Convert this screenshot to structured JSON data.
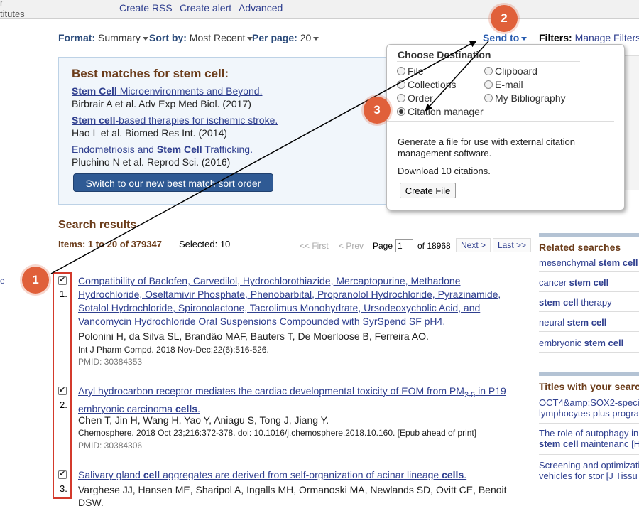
{
  "topbar": {
    "left_fragment_top": "r",
    "left_fragment": "titutes",
    "links": [
      "Create RSS",
      "Create alert",
      "Advanced"
    ]
  },
  "toolbar": {
    "format_label": "Format:",
    "format_value": "Summary",
    "sort_label": "Sort by:",
    "sort_value": "Most Recent",
    "perpage_label": "Per page:",
    "perpage_value": "20",
    "send_to": "Send to",
    "filters_label": "Filters:",
    "filters_link": "Manage Filters"
  },
  "best_matches": {
    "title": "Best matches for stem cell:",
    "items": [
      {
        "bold": "Stem Cell",
        "rest": " Microenvironments and Beyond.",
        "source": "Birbrair A et al. Adv Exp Med Biol. (2017)"
      },
      {
        "bold": "Stem cell",
        "rest": "-based therapies for ischemic stroke.",
        "source": "Hao L et al. Biomed Res Int. (2014)"
      },
      {
        "pre": "Endometriosis and ",
        "bold": "Stem Cell",
        "rest": " Trafficking.",
        "source": "Pluchino N et al. Reprod Sci. (2016)"
      }
    ],
    "switch_button": "Switch to our new best match sort order"
  },
  "destination": {
    "heading": "Choose Destination",
    "options": [
      "File",
      "Clipboard",
      "Collections",
      "E-mail",
      "Order",
      "My Bibliography",
      "Citation manager"
    ],
    "selected": "Citation manager",
    "description": "Generate a file for use with external citation management software.",
    "count": "Download 10 citations.",
    "button": "Create File"
  },
  "results": {
    "title": "Search results",
    "items_label": "Items: 1 to 20 of 379347",
    "selected_label": "Selected: 10",
    "pager": {
      "first": "<< First",
      "prev": "< Prev",
      "page_label": "Page",
      "page_value": "1",
      "of": "of 18968",
      "next": "Next >",
      "last": "Last >>"
    },
    "list": [
      {
        "num": "1.",
        "title": "Compatibility of Baclofen, Carvedilol, Hydrochlorothiazide, Mercaptopurine, Methadone Hydrochloride, Oseltamivir Phosphate, Phenobarbital, Propranolol Hydrochloride, Pyrazinamide, Sotalol Hydrochloride, Spironolactone, Tacrolimus Monohydrate, Ursodeoxycholic Acid, and Vancomycin Hydrochloride Oral Suspensions Compounded with SyrSpend SF pH4.",
        "authors": "Polonini H, da Silva SL, Brandão MAF, Bauters T, De Moerloose B, Ferreira AO.",
        "source": "Int J Pharm Compd. 2018 Nov-Dec;22(6):516-526.",
        "pmid": "PMID: 30384353"
      },
      {
        "num": "2.",
        "title_pre": "Aryl hydrocarbon receptor mediates the cardiac developmental toxicity of EOM from PM",
        "title_sub": "2.5",
        "title_mid": " in P19 embryonic carcinoma ",
        "title_bold": "cells",
        "title_end": ".",
        "authors": "Chen T, Jin H, Wang H, Yao Y, Aniagu S, Tong J, Jiang Y.",
        "source": "Chemosphere. 2018 Oct 23;216:372-378. doi: 10.1016/j.chemosphere.2018.10.160. [Epub ahead of print]",
        "pmid": "PMID: 30384306"
      },
      {
        "num": "3.",
        "title_pre": "Salivary gland ",
        "title_b1": "cell",
        "title_mid": " aggregates are derived from self-organization of acinar lineage ",
        "title_b2": "cells",
        "title_end": ".",
        "authors": "Varghese JJ, Hansen ME, Sharipol A, Ingalls MH, Ormanoski MA, Newlands SD, Ovitt CE, Benoit DSW."
      }
    ]
  },
  "sidebar": {
    "related_title": "Related searches",
    "related": [
      {
        "pre": "mesenchymal ",
        "bold": "stem cell"
      },
      {
        "pre": "cancer ",
        "bold": "stem cell"
      },
      {
        "pre": "",
        "bold": "stem cell",
        "post": " therapy"
      },
      {
        "pre": "neural ",
        "bold": "stem cell"
      },
      {
        "pre": "embryonic ",
        "bold": "stem cell"
      }
    ],
    "titles_title": "Titles with your searc",
    "titles": [
      {
        "l1": "OCT4&amp;SOX2-speci",
        "l2": "lymphocytes plus progra"
      },
      {
        "l1": "The role of autophagy in",
        "l2b": "stem cell",
        "l2": " maintenanc [H"
      },
      {
        "l1": "Screening and optimizati",
        "l2": "vehicles for stor [J Tissu"
      }
    ]
  },
  "callouts": [
    "1",
    "2",
    "3"
  ],
  "left_fragment": "e",
  "colors": {
    "callout": "#e0603a",
    "frame": "#d33a2c",
    "link": "#2f3f8f",
    "heading": "#6b3c1a",
    "button": "#2f5a94"
  }
}
